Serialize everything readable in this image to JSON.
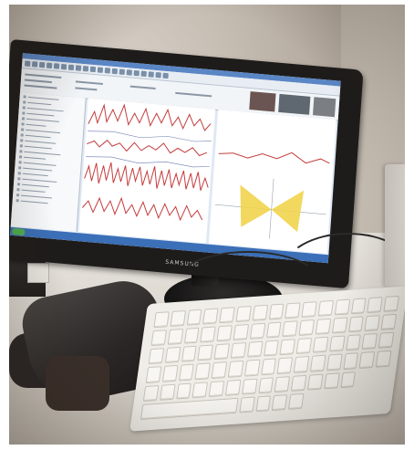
{
  "photo": {
    "description_free": true,
    "monitor_brand": "SAMSUNG",
    "colors": {
      "wall": "#b8aea3",
      "desk": "#e1ddd6",
      "bezel": "#1e1c1b",
      "screen": "#dfe9f5",
      "plot_red": "#c43c3c",
      "plot_yellow": "#f1d44c",
      "keyboard": "#efede8"
    }
  }
}
